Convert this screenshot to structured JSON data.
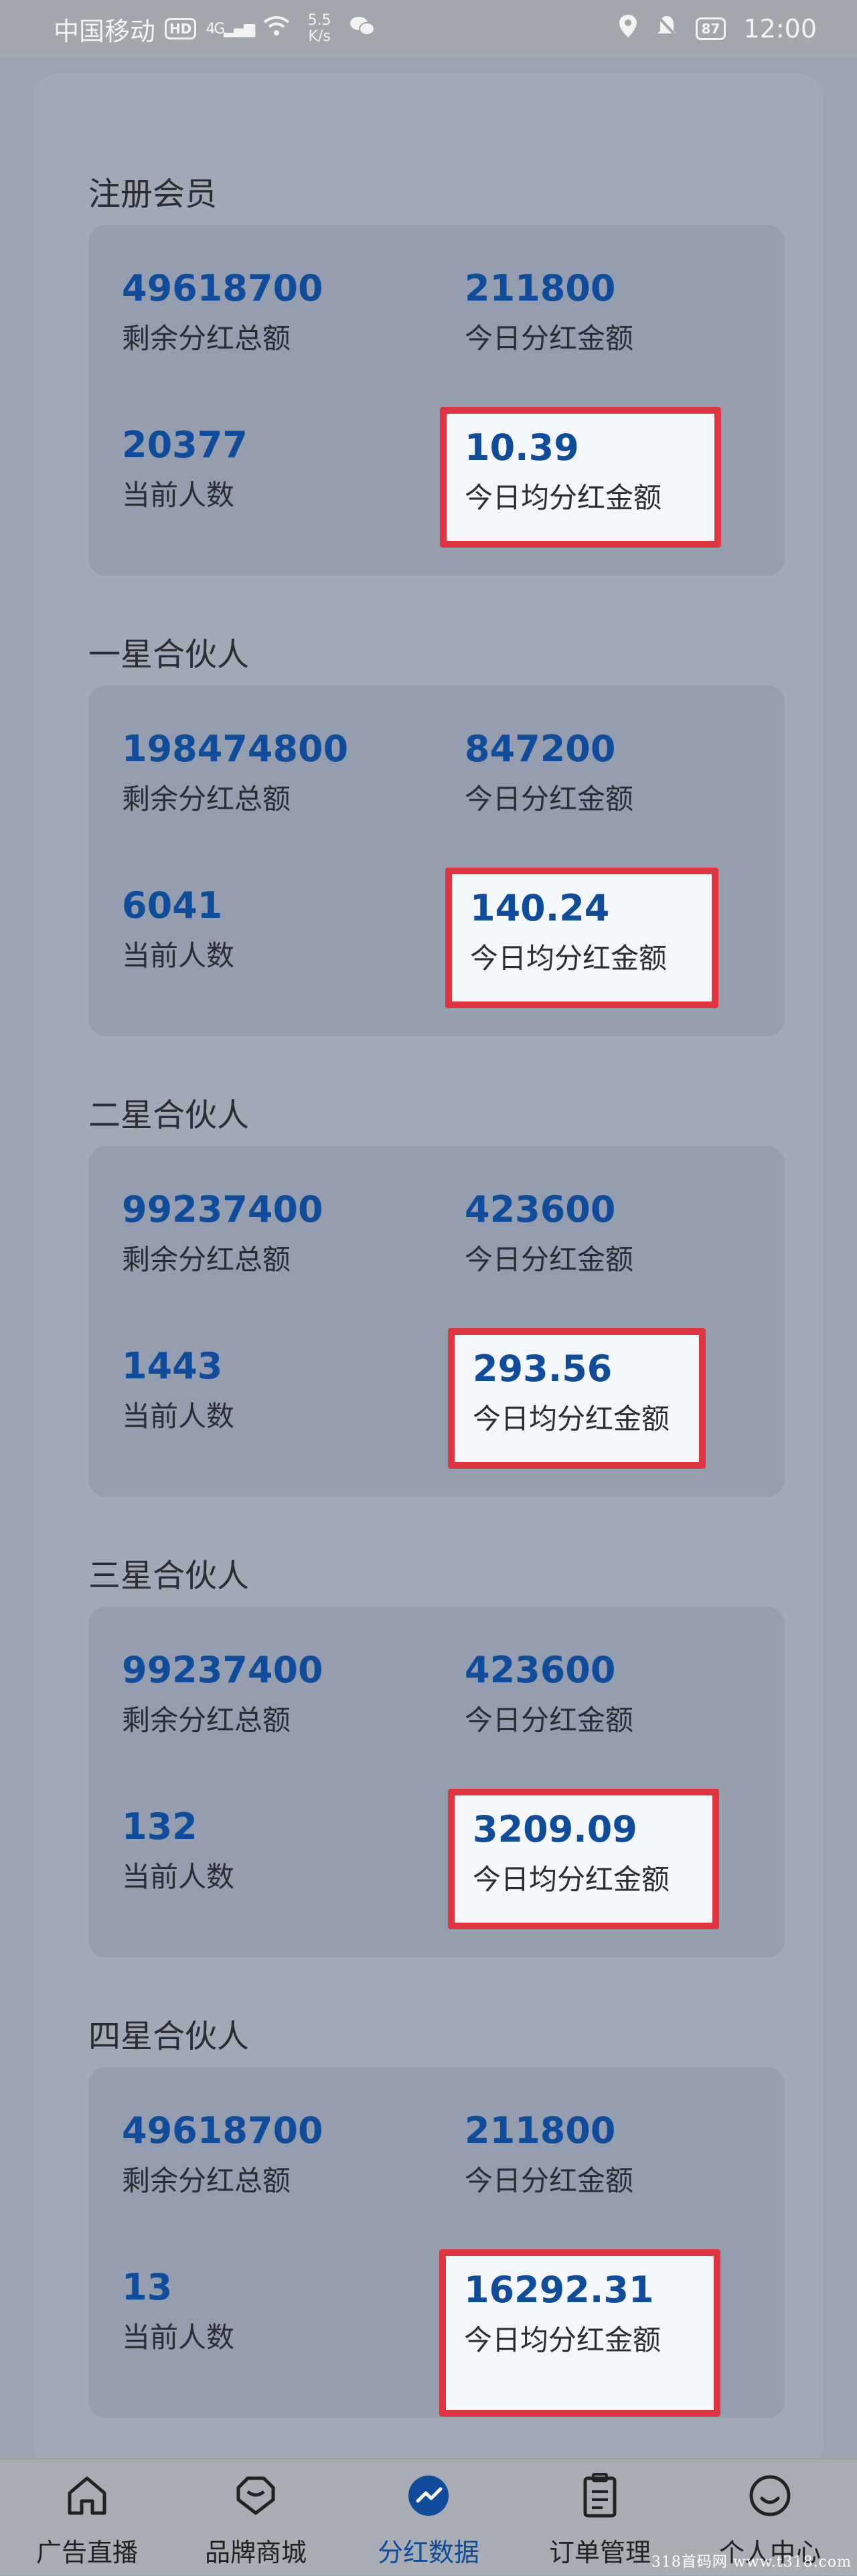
{
  "status_bar": {
    "carrier": "中国移动",
    "network_badge": "HD",
    "signal_text": "4G",
    "speed_value": "5.5",
    "speed_unit": "K/s",
    "battery": "87",
    "time": "12:00"
  },
  "sections": [
    {
      "title": "注册会员",
      "total_remaining": "49618700",
      "total_remaining_label": "剩余分红总额",
      "today_amount": "211800",
      "today_amount_label": "今日分红金额",
      "current_count": "20377",
      "current_count_label": "当前人数",
      "avg_today": "10.39",
      "avg_today_label": "今日均分红金额"
    },
    {
      "title": "一星合伙人",
      "total_remaining": "198474800",
      "total_remaining_label": "剩余分红总额",
      "today_amount": "847200",
      "today_amount_label": "今日分红金额",
      "current_count": "6041",
      "current_count_label": "当前人数",
      "avg_today": "140.24",
      "avg_today_label": "今日均分红金额"
    },
    {
      "title": "二星合伙人",
      "total_remaining": "99237400",
      "total_remaining_label": "剩余分红总额",
      "today_amount": "423600",
      "today_amount_label": "今日分红金额",
      "current_count": "1443",
      "current_count_label": "当前人数",
      "avg_today": "293.56",
      "avg_today_label": "今日均分红金额"
    },
    {
      "title": "三星合伙人",
      "total_remaining": "99237400",
      "total_remaining_label": "剩余分红总额",
      "today_amount": "423600",
      "today_amount_label": "今日分红金额",
      "current_count": "132",
      "current_count_label": "当前人数",
      "avg_today": "3209.09",
      "avg_today_label": "今日均分红金额"
    },
    {
      "title": "四星合伙人",
      "total_remaining": "49618700",
      "total_remaining_label": "剩余分红总额",
      "today_amount": "211800",
      "today_amount_label": "今日分红金额",
      "current_count": "13",
      "current_count_label": "当前人数",
      "avg_today": "16292.31",
      "avg_today_label": "今日均分红金额"
    }
  ],
  "tab_bar": {
    "active_index": 2,
    "tabs": [
      {
        "label": "广告直播",
        "icon": "home-icon"
      },
      {
        "label": "品牌商城",
        "icon": "tag-icon"
      },
      {
        "label": "分红数据",
        "icon": "trend-icon"
      },
      {
        "label": "订单管理",
        "icon": "clipboard-icon"
      },
      {
        "label": "个人中心",
        "icon": "smiley-icon"
      }
    ]
  },
  "watermark": "318首码网 www.t318.com",
  "colors": {
    "accent": "#0f4c9c",
    "highlight_border": "#e0353e",
    "overlay_background": "#9ca4b1"
  }
}
